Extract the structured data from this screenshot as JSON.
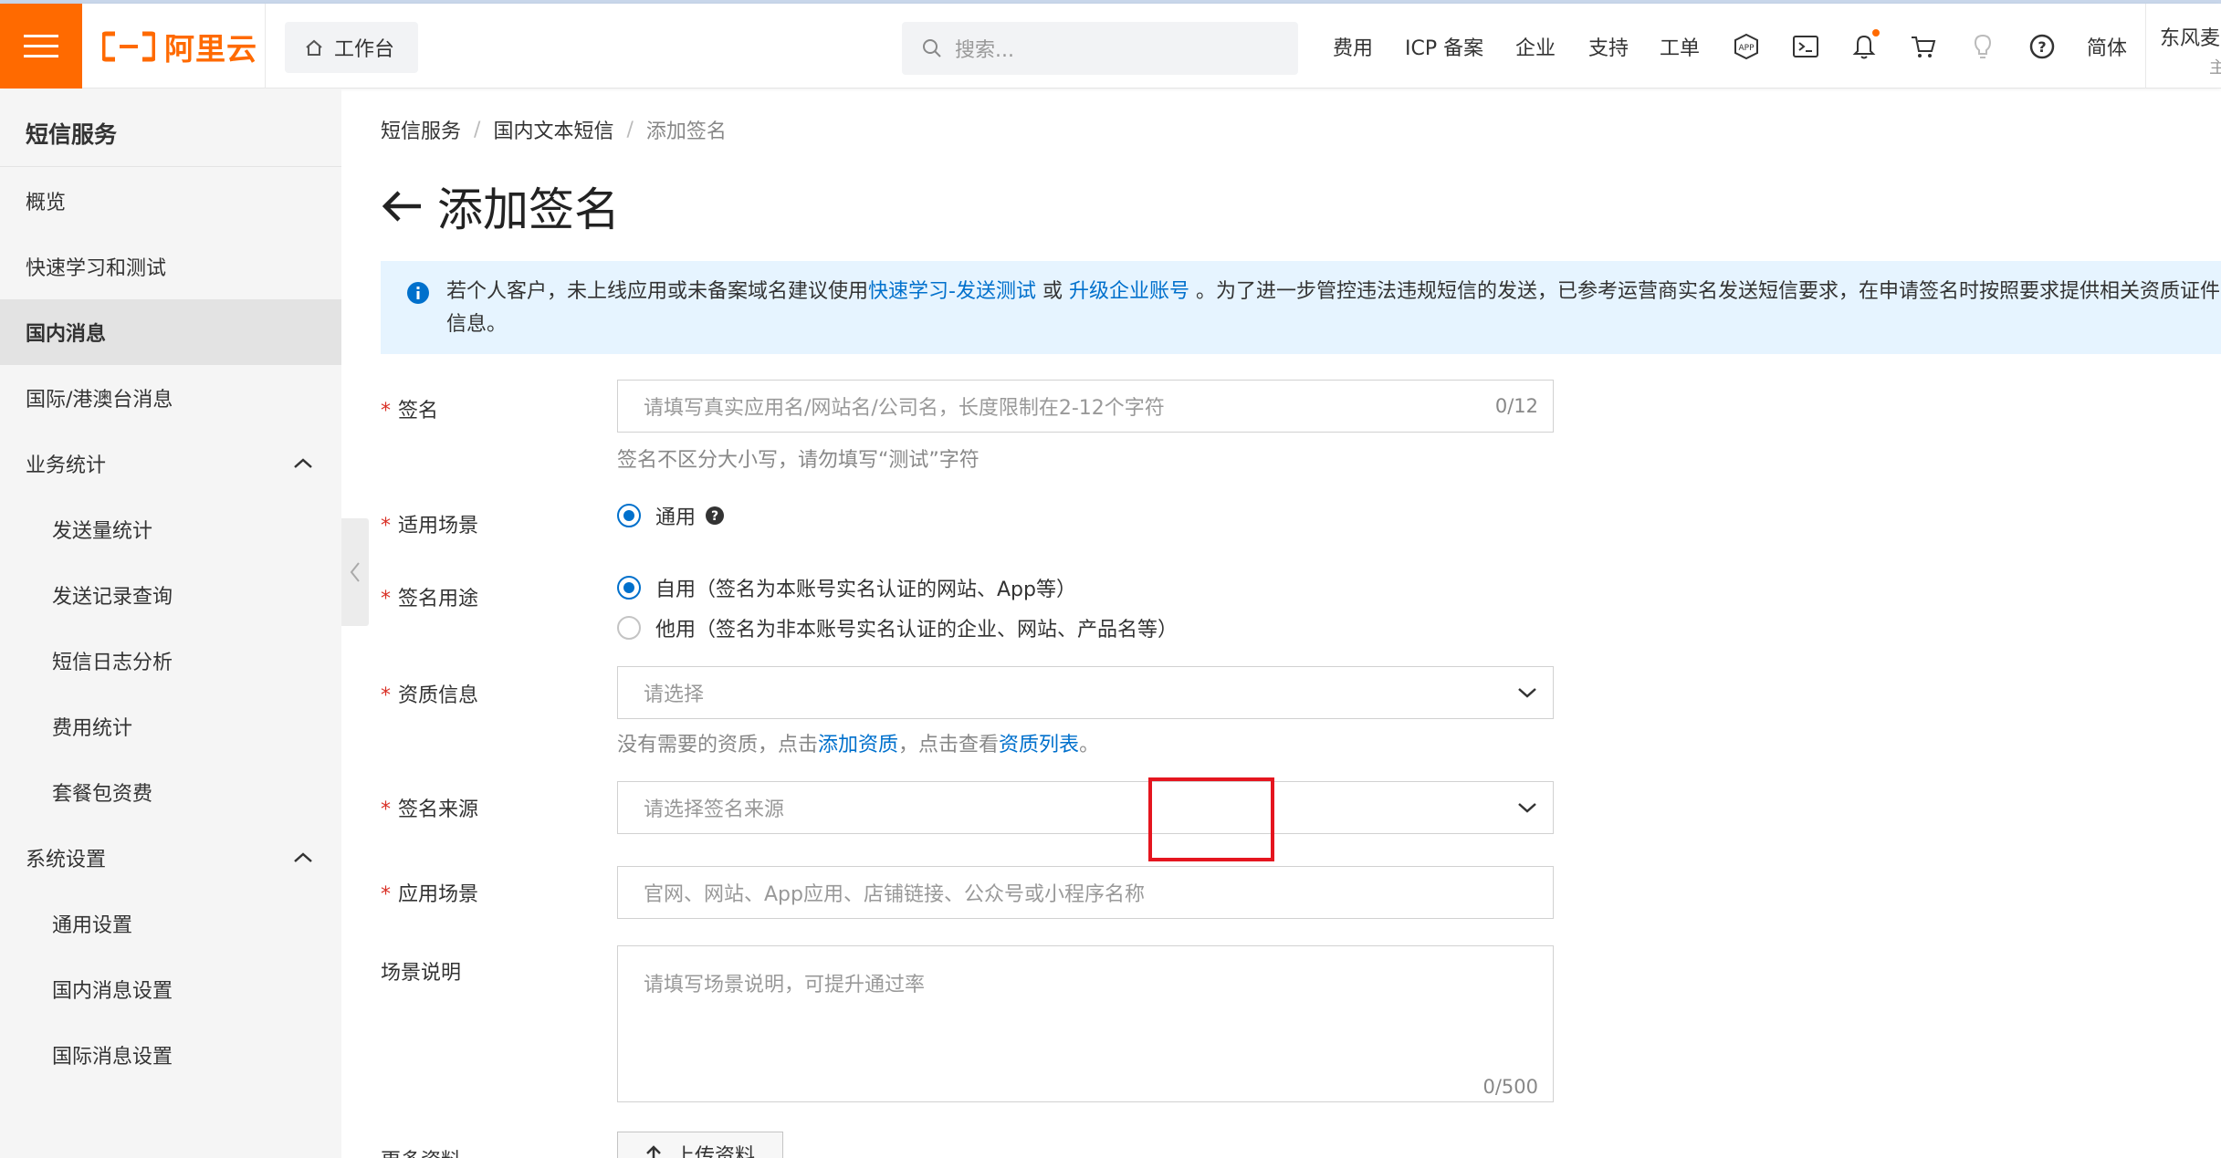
{
  "header": {
    "logo_text": "阿里云",
    "workbench_label": "工作台",
    "search_placeholder": "搜索...",
    "nav": [
      "费用",
      "ICP 备案",
      "企业",
      "支持",
      "工单"
    ],
    "lang": "简体",
    "user": "东风麦",
    "user_sub": "主"
  },
  "sidebar": {
    "title": "短信服务",
    "items": [
      {
        "label": "概览"
      },
      {
        "label": "快速学习和测试"
      },
      {
        "label": "国内消息"
      },
      {
        "label": "国际/港澳台消息"
      },
      {
        "label": "业务统计"
      },
      {
        "label": "发送量统计"
      },
      {
        "label": "发送记录查询"
      },
      {
        "label": "短信日志分析"
      },
      {
        "label": "费用统计"
      },
      {
        "label": "套餐包资费"
      },
      {
        "label": "系统设置"
      },
      {
        "label": "通用设置"
      },
      {
        "label": "国内消息设置"
      },
      {
        "label": "国际消息设置"
      }
    ]
  },
  "breadcrumb": [
    "短信服务",
    "国内文本短信",
    "添加签名"
  ],
  "page_title": "添加签名",
  "notice": {
    "t1": "若个人客户，未上线应用或未备案域名建议使用",
    "link1": "快速学习-发送测试",
    "t2": " 或 ",
    "link2": "升级企业账号",
    "t3": " 。为了进一步管控违法违规短信的发送，已参考运营商实名发送短信要求，在申请签名时按照要求提供相关资质证件信息。"
  },
  "form": {
    "signature": {
      "label": "签名",
      "placeholder": "请填写真实应用名/网站名/公司名，长度限制在2-12个字符",
      "count": "0/12",
      "hint": "签名不区分大小写，请勿填写“测试”字符"
    },
    "scene": {
      "label": "适用场景",
      "option": "通用"
    },
    "purpose": {
      "label": "签名用途",
      "option1": "自用（签名为本账号实名认证的网站、App等）",
      "option2": "他用（签名为非本账号实名认证的企业、网站、产品名等）"
    },
    "qualification": {
      "label": "资质信息",
      "placeholder": "请选择",
      "hint_pre": "没有需要的资质，点击",
      "hint_link1": "添加资质",
      "hint_mid": "，点击查看",
      "hint_link2": "资质列表",
      "hint_end": "。"
    },
    "source": {
      "label": "签名来源",
      "placeholder": "请选择签名来源"
    },
    "app_scene": {
      "label": "应用场景",
      "placeholder": "官网、网站、App应用、店铺链接、公众号或小程序名称"
    },
    "scene_desc": {
      "label": "场景说明",
      "placeholder": "请填写场景说明，可提升通过率",
      "count": "0/500"
    },
    "more": {
      "label": "更多资料",
      "upload": "上传资料"
    }
  }
}
